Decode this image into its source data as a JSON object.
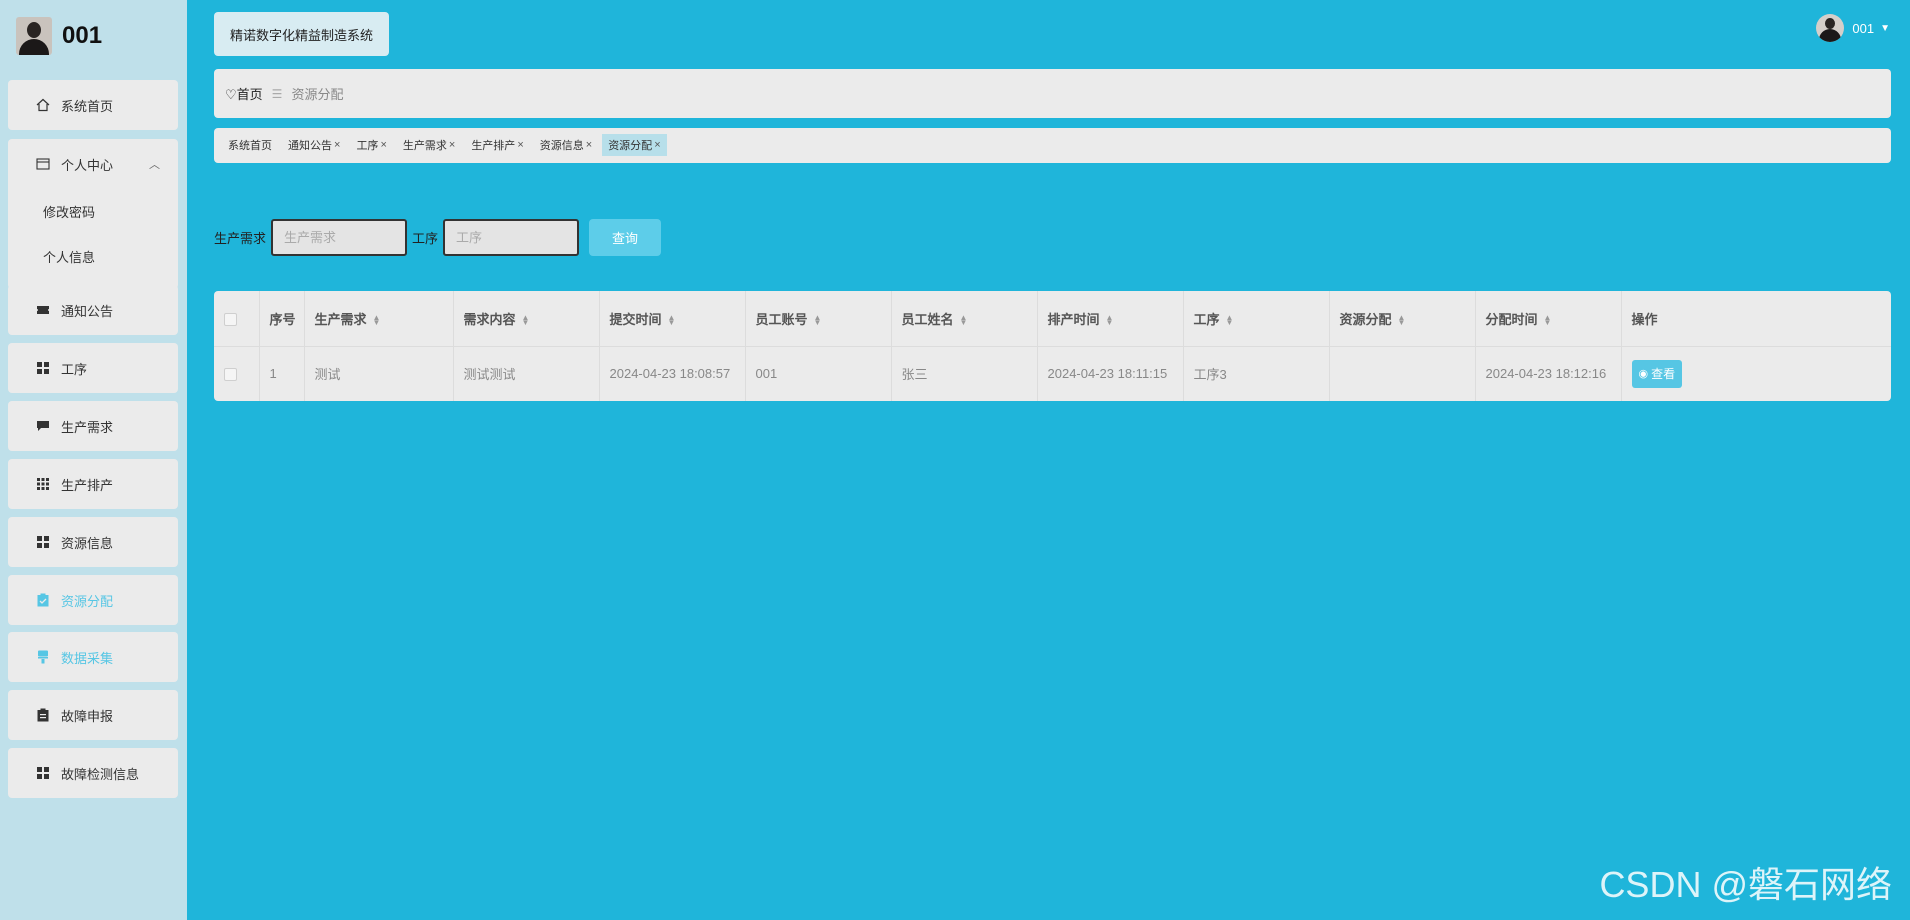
{
  "brand": {
    "name": "001"
  },
  "header": {
    "system_title": "精诺数字化精益制造系统",
    "user_name": "001"
  },
  "sidebar": {
    "items": [
      {
        "label": "系统首页",
        "icon": "home-icon"
      },
      {
        "label": "个人中心",
        "icon": "card-icon",
        "sub": [
          "修改密码",
          "个人信息"
        ]
      },
      {
        "label": "通知公告",
        "icon": "ticket-icon"
      },
      {
        "label": "工序",
        "icon": "grid-icon"
      },
      {
        "label": "生产需求",
        "icon": "message-icon"
      },
      {
        "label": "生产排产",
        "icon": "apps-icon"
      },
      {
        "label": "资源信息",
        "icon": "grid-icon"
      },
      {
        "label": "资源分配",
        "icon": "clipboard-icon"
      },
      {
        "label": "数据采集",
        "icon": "brush-icon"
      },
      {
        "label": "故障申报",
        "icon": "clipboard-icon"
      },
      {
        "label": "故障检测信息",
        "icon": "grid-icon"
      }
    ]
  },
  "breadcrumb": {
    "home": "首页",
    "current": "资源分配"
  },
  "tabs": [
    "系统首页",
    "通知公告",
    "工序",
    "生产需求",
    "生产排产",
    "资源信息",
    "资源分配"
  ],
  "search": {
    "demand_label": "生产需求",
    "demand_placeholder": "生产需求",
    "process_label": "工序",
    "process_placeholder": "工序",
    "query_button": "查询"
  },
  "table": {
    "columns": [
      "序号",
      "生产需求",
      "需求内容",
      "提交时间",
      "员工账号",
      "员工姓名",
      "排产时间",
      "工序",
      "资源分配",
      "分配时间",
      "操作"
    ],
    "rows": [
      [
        "1",
        "测试",
        "测试测试",
        "2024-04-23 18:08:57",
        "001",
        "张三",
        "2024-04-23 18:11:15",
        "工序3",
        "",
        "2024-04-23 18:12:16"
      ]
    ],
    "action_label": "查看"
  },
  "watermark": "CSDN @磐石网络",
  "colors": {
    "background": "#1fb5da",
    "sidebar": "#bfe0ea",
    "accent": "#56c6e4"
  }
}
